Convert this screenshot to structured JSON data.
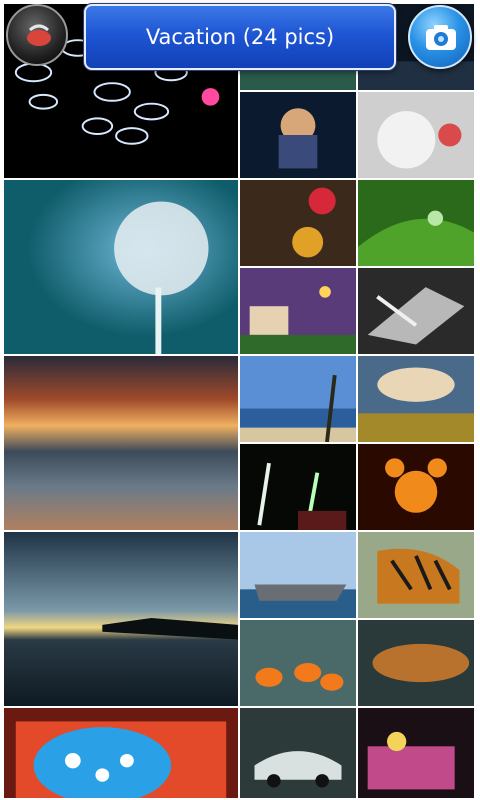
{
  "header": {
    "album_title": "Vacation (24 pics)",
    "back_icon": "album-back-icon",
    "camera_icon": "camera-icon"
  },
  "grid": {
    "tiles": [
      {
        "name": "photo-fish-neon"
      },
      {
        "name": "photo-fantasy-woman"
      },
      {
        "name": "photo-white-teddy"
      },
      {
        "name": "photo-dandelion"
      },
      {
        "name": "photo-pooh-balloon"
      },
      {
        "name": "photo-green-leaf-drop"
      },
      {
        "name": "photo-castle-garden"
      },
      {
        "name": "photo-glass-art"
      },
      {
        "name": "photo-beach-sunset"
      },
      {
        "name": "photo-palm-beach"
      },
      {
        "name": "photo-field-clouds"
      },
      {
        "name": "photo-fireworks"
      },
      {
        "name": "photo-mickey-lanterns"
      },
      {
        "name": "photo-lake-sunset"
      },
      {
        "name": "photo-battleship"
      },
      {
        "name": "photo-tiger"
      },
      {
        "name": "photo-clownfish"
      },
      {
        "name": "photo-bronze-capsule"
      },
      {
        "name": "photo-blue-whale-painting"
      },
      {
        "name": "photo-sports-car"
      },
      {
        "name": "photo-parade-float"
      }
    ]
  }
}
